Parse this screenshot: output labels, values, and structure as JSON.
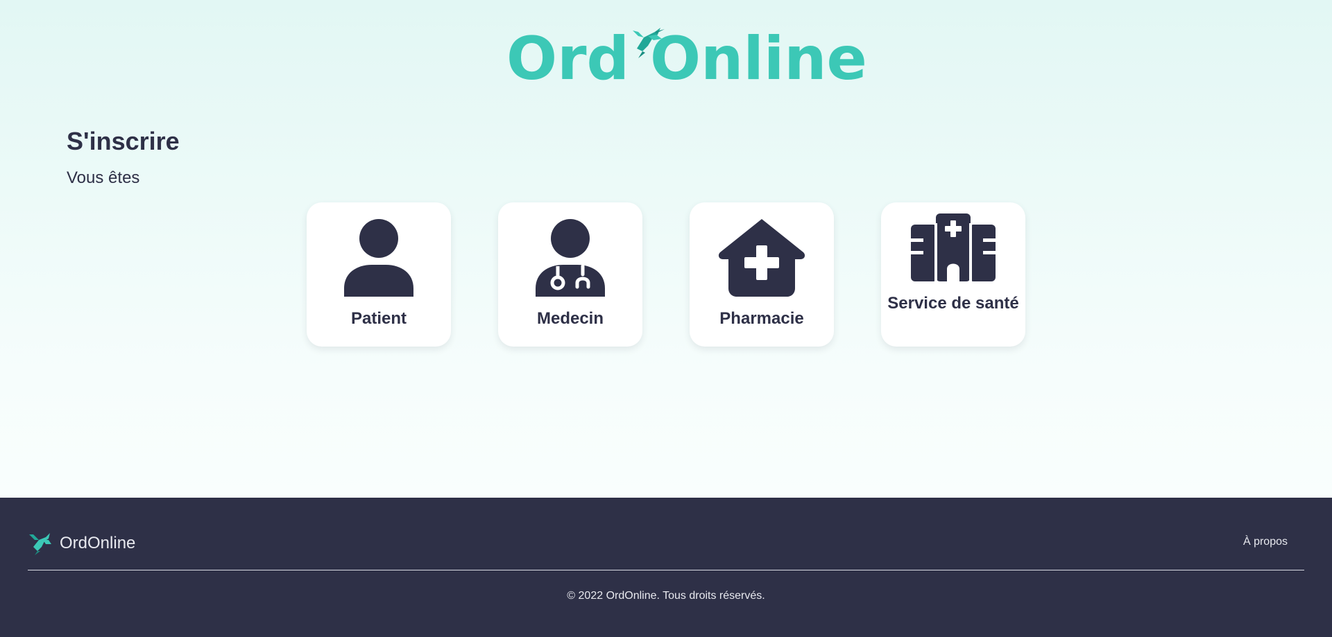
{
  "brand": {
    "name": "OrdOnline",
    "logo_text": "Ord Online",
    "accent_color": "#3cc8b6",
    "dark_color": "#2e3047"
  },
  "page": {
    "title": "S'inscrire",
    "subtitle": "Vous êtes"
  },
  "roles": [
    {
      "label": "Patient",
      "icon": "person-icon"
    },
    {
      "label": "Medecin",
      "icon": "doctor-icon"
    },
    {
      "label": "Pharmacie",
      "icon": "pharmacy-icon"
    },
    {
      "label": "Service de santé",
      "icon": "hospital-icon"
    }
  ],
  "footer": {
    "brand_name": "OrdOnline",
    "about_link": "À propos",
    "copyright": "© 2022 OrdOnline. Tous droits réservés."
  }
}
